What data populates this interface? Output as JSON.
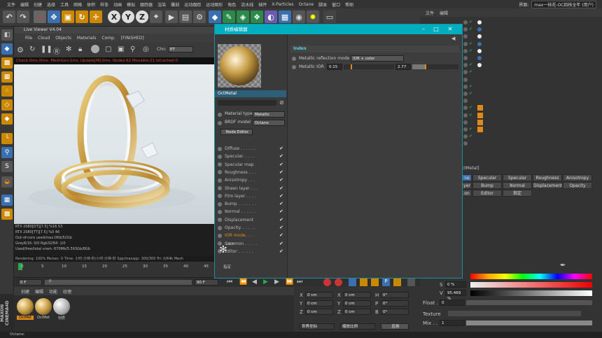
{
  "menubar": {
    "items": [
      "文件",
      "编辑",
      "创建",
      "选择",
      "工具",
      "网格",
      "体积",
      "样条",
      "动画",
      "模拟",
      "跟踪器",
      "渲染",
      "雕刻",
      "运动跟踪",
      "运动图形",
      "角色",
      "流水线",
      "插件",
      "X-Particles",
      "Octane",
      "脚本",
      "窗口",
      "帮助"
    ],
    "interface_label": "界面:",
    "interface_value": "max一核花-OC四核全年 (用户)"
  },
  "viewer": {
    "title": "Live Viewer V4.04",
    "menu": [
      "File",
      "Cloud",
      "Objects",
      "Materials",
      "Comp.",
      "[FINISHED]"
    ],
    "channel_label": "Chn:",
    "channel_value": "PT",
    "status_line": "Check:0ms./0ms. MeshGen:1ms. Update[M]:0ms. Nodes:62 Movable:21 txCached:0",
    "stats": [
      "RTX 2080[DT][7.5]    %16    53",
      "RTX 2080[TT][7.5]    %0     46",
      "Out-of-core used/max:0Kb/52Gb",
      "Grey8/16: 0/0       Rgb32/64: 1/0",
      "Used/free/total vram: 670Mb/5.593Gb/8Gb"
    ],
    "render_bar": "Rendering: 100%  Ms/sec: 0  Time: 小时:分钟:秒/小时:分钟:秒  Spp/maxspp: 300/300  Tri: 0/64k  Mesh"
  },
  "timeline": {
    "ticks": [
      "0",
      "5",
      "10",
      "15",
      "20",
      "25",
      "30",
      "35",
      "40",
      "45"
    ],
    "start": "0 F",
    "mid": "0",
    "end": "90 F",
    "end2": "90 F"
  },
  "material_manager": {
    "menu": [
      "创建",
      "编辑",
      "功能",
      "纹理"
    ],
    "materials": [
      "OctMet",
      "OctMet",
      "材质"
    ]
  },
  "material_editor": {
    "title": "材质编辑器",
    "material_name": "OctMetal",
    "fields": {
      "material_type_label": "Material type",
      "material_type_value": "Metallic",
      "brdf_label": "BRDF model",
      "brdf_value": "Octane"
    },
    "node_editor_button": "Node Editor",
    "channels": [
      {
        "label": "Diffuse . . . . . .",
        "checked": true,
        "active": false
      },
      {
        "label": "Specular. . . . .",
        "checked": true,
        "active": false
      },
      {
        "label": "Specular map",
        "checked": true,
        "active": false
      },
      {
        "label": "Roughness . . .",
        "checked": true,
        "active": false
      },
      {
        "label": "Anisotropy . . .",
        "checked": true,
        "active": false
      },
      {
        "label": "Sheen layer . . .",
        "checked": true,
        "active": false
      },
      {
        "label": "Film layer . . . .",
        "checked": true,
        "active": false
      },
      {
        "label": "Bump . . . . . . .",
        "checked": true,
        "active": false
      },
      {
        "label": "Normal . . . . . .",
        "checked": true,
        "active": false
      },
      {
        "label": "Displacement",
        "checked": true,
        "active": false
      },
      {
        "label": "Opacity. . . . . .",
        "checked": true,
        "active": false
      },
      {
        "label": "IOR mode. . . .",
        "checked": true,
        "active": true
      },
      {
        "label": "Common . . . . .",
        "checked": true,
        "active": false
      },
      {
        "label": "Editor . . . . . .",
        "checked": true,
        "active": false
      }
    ],
    "help_label": "HELP",
    "assign_label": "指定",
    "right": {
      "section": "Index",
      "reflection_label": "Metallic reflection mode",
      "reflection_value": "IOR + color",
      "ior_label": "Metallic IOR",
      "ior_value1": "0.15",
      "ior_value2": "2.77"
    }
  },
  "attributes": {
    "crumb": "ctMetal]",
    "tabs_row1": [
      "ne",
      "Specular",
      "Specular map",
      "Roughness",
      "Anisotropy"
    ],
    "tabs_row2": [
      "yer",
      "Bump",
      "Normal",
      "Displacement",
      "Opacity"
    ],
    "tabs_row3": [
      "on",
      "Editor",
      "指定"
    ]
  },
  "color": {
    "s_label": "S",
    "s_value": "0 %",
    "v_label": "V",
    "v_value": "95.469 %",
    "float_label": "Float .",
    "float_value": "0",
    "texture_label": "Texture",
    "mix_label": "Mix . .",
    "mix_value": "1"
  },
  "coords": {
    "x_label": "X",
    "y_label": "Y",
    "z_label": "Z",
    "h_label": "H",
    "p_label": "P",
    "b_label": "B",
    "x_value": "0 cm",
    "y_value": "0 cm",
    "z_value": "0 cm",
    "angle": "0°",
    "mode1": "世界坐标",
    "mode2": "缩放比例",
    "apply": "应用"
  },
  "bottom_status": "Octane:",
  "colors": {
    "accent": "#00aec0",
    "ior_orange": "#e08a1a",
    "gold": "#c9a24a"
  }
}
